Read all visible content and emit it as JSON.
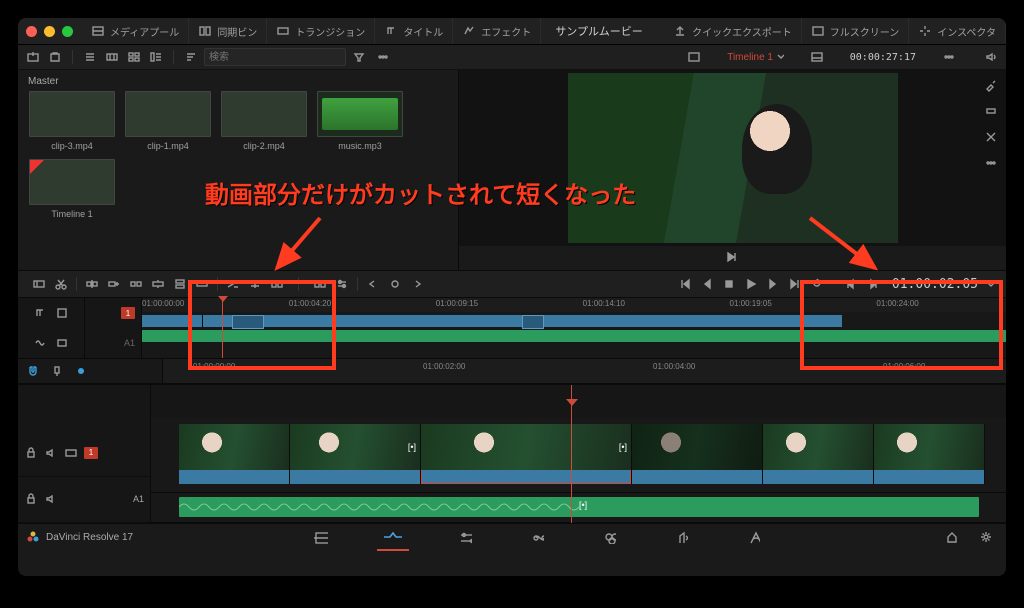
{
  "annotation": {
    "text": "動画部分だけがカットされて短くなった"
  },
  "topbar": {
    "media_pool": "メディアプール",
    "sync_bin": "同期ビン",
    "transitions": "トランジション",
    "titles": "タイトル",
    "effects": "エフェクト",
    "project_title": "サンプルムービー",
    "quick_export": "クイックエクスポート",
    "fullscreen": "フルスクリーン",
    "inspector": "インスペクタ"
  },
  "pool": {
    "master": "Master",
    "search_placeholder": "検索",
    "clips": [
      {
        "name": "clip-3.mp4"
      },
      {
        "name": "clip-1.mp4"
      },
      {
        "name": "clip-2.mp4"
      },
      {
        "name": "music.mp3"
      },
      {
        "name": "Timeline 1"
      }
    ]
  },
  "viewer": {
    "timeline_name": "Timeline 1",
    "timecode_right": "00:00:27:17",
    "timecode_toolbar": "01:00:02:05"
  },
  "mini_ruler": [
    "01:00:00:00",
    "01:00:04:20",
    "01:00:09:15",
    "01:00:14:10",
    "01:00:19:05",
    "01:00:24:00"
  ],
  "main_ruler": [
    "01:00:00:00",
    "01:00:02:00",
    "01:00:04:00",
    "01:00:06:00"
  ],
  "tracks": {
    "v1": "1",
    "a1": "A1",
    "a1_label": "A1"
  },
  "footer": {
    "app": "DaVinci Resolve 17"
  }
}
